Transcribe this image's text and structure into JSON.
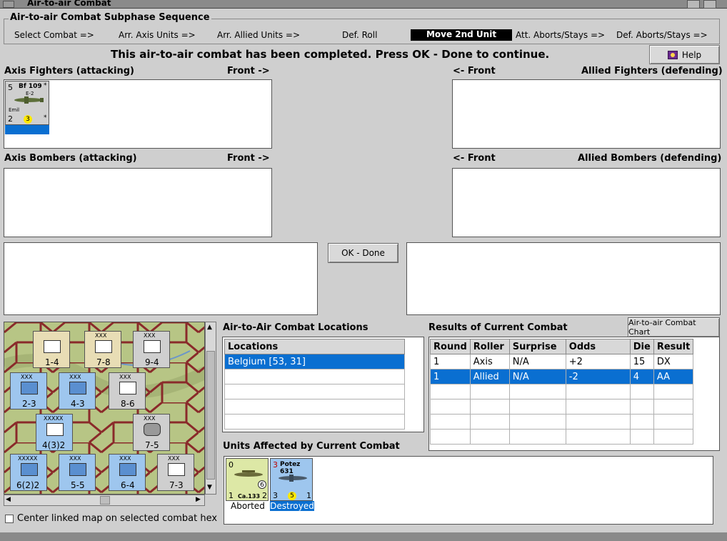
{
  "window": {
    "title": "Air-to-air Combat"
  },
  "sequence": {
    "title": "Air-to-air Combat Subphase Sequence",
    "steps": [
      "Select Combat =>",
      "Arr. Axis Units =>",
      "Arr. Allied Units =>",
      "Def. Roll",
      "Move 2nd Unit",
      "Att. Aborts/Stays =>",
      "Def. Aborts/Stays =>"
    ],
    "active_step": "Move 2nd Unit"
  },
  "message": "This air-to-air combat has been completed.  Press OK - Done to continue.",
  "help_label": "Help",
  "boxes": {
    "axis_fighters": "Axis Fighters (attacking)",
    "axis_fighters_front": "Front ->",
    "allied_fighters": "Allied Fighters (defending)",
    "allied_fighters_front": "<- Front",
    "axis_bombers": "Axis Bombers (attacking)",
    "axis_bombers_front": "Front ->",
    "allied_bombers": "Allied Bombers (defending)",
    "allied_bombers_front": "<- Front"
  },
  "fighter_counter": {
    "top_left": "5",
    "name": "Bf 109",
    "variant": "E-2",
    "sub": "Emil",
    "bottom_left": "2",
    "circle": "3",
    "star": "*"
  },
  "ok_label": "OK - Done",
  "map_counters": [
    {
      "top": "",
      "id": "1-4",
      "color": "tan"
    },
    {
      "top": "XXX",
      "id": "7-8",
      "color": "tan"
    },
    {
      "top": "XXX",
      "id": "9-4",
      "color": "grey"
    },
    {
      "top": "XXX",
      "id": "2-3",
      "color": "blue"
    },
    {
      "top": "XXX",
      "id": "4-3",
      "color": "blue"
    },
    {
      "top": "XXX",
      "id": "8-6",
      "color": "grey"
    },
    {
      "top": "XXXXX",
      "id": "4(3)2",
      "color": "blue"
    },
    {
      "top": "XXX",
      "id": "7-5",
      "color": "grey"
    },
    {
      "top": "XXXXX",
      "id": "6(2)2",
      "color": "blue"
    },
    {
      "top": "XXX",
      "id": "5-5",
      "color": "blue"
    },
    {
      "top": "XXX",
      "id": "6-4",
      "color": "blue"
    },
    {
      "top": "XXX",
      "id": "7-3",
      "color": "grey"
    }
  ],
  "center_map_label": "Center linked map on selected combat hex",
  "locations": {
    "title": "Air-to-Air Combat Locations",
    "header": "Locations",
    "rows": [
      "Belgium [53, 31]"
    ]
  },
  "results": {
    "title": "Results of Current Combat",
    "chart_button": "Air-to-air Combat Chart",
    "headers": [
      "Round",
      "Roller",
      "Surprise",
      "Odds",
      "Die",
      "Result"
    ],
    "rows": [
      [
        "1",
        "Axis",
        "N/A",
        "+2",
        "15",
        "DX"
      ],
      [
        "1",
        "Allied",
        "N/A",
        "-2",
        "4",
        "AA"
      ]
    ]
  },
  "affected": {
    "title": "Units Affected by Current Combat",
    "units": [
      {
        "top_left": "0",
        "name": "Ca.133",
        "circle": "6",
        "bottom_left": "1",
        "bottom_right": "2",
        "status": "Aborted",
        "color": "yellowgreen"
      },
      {
        "top_left": "3",
        "name": "Potez 631",
        "circle": "5",
        "bottom_left": "3",
        "bottom_right": "1",
        "status": "Destroyed",
        "color": "blue"
      }
    ]
  },
  "colors": {
    "selection": "#0a6fd1",
    "active_step_bg": "#000000",
    "window_bg": "#cfcfcf"
  }
}
